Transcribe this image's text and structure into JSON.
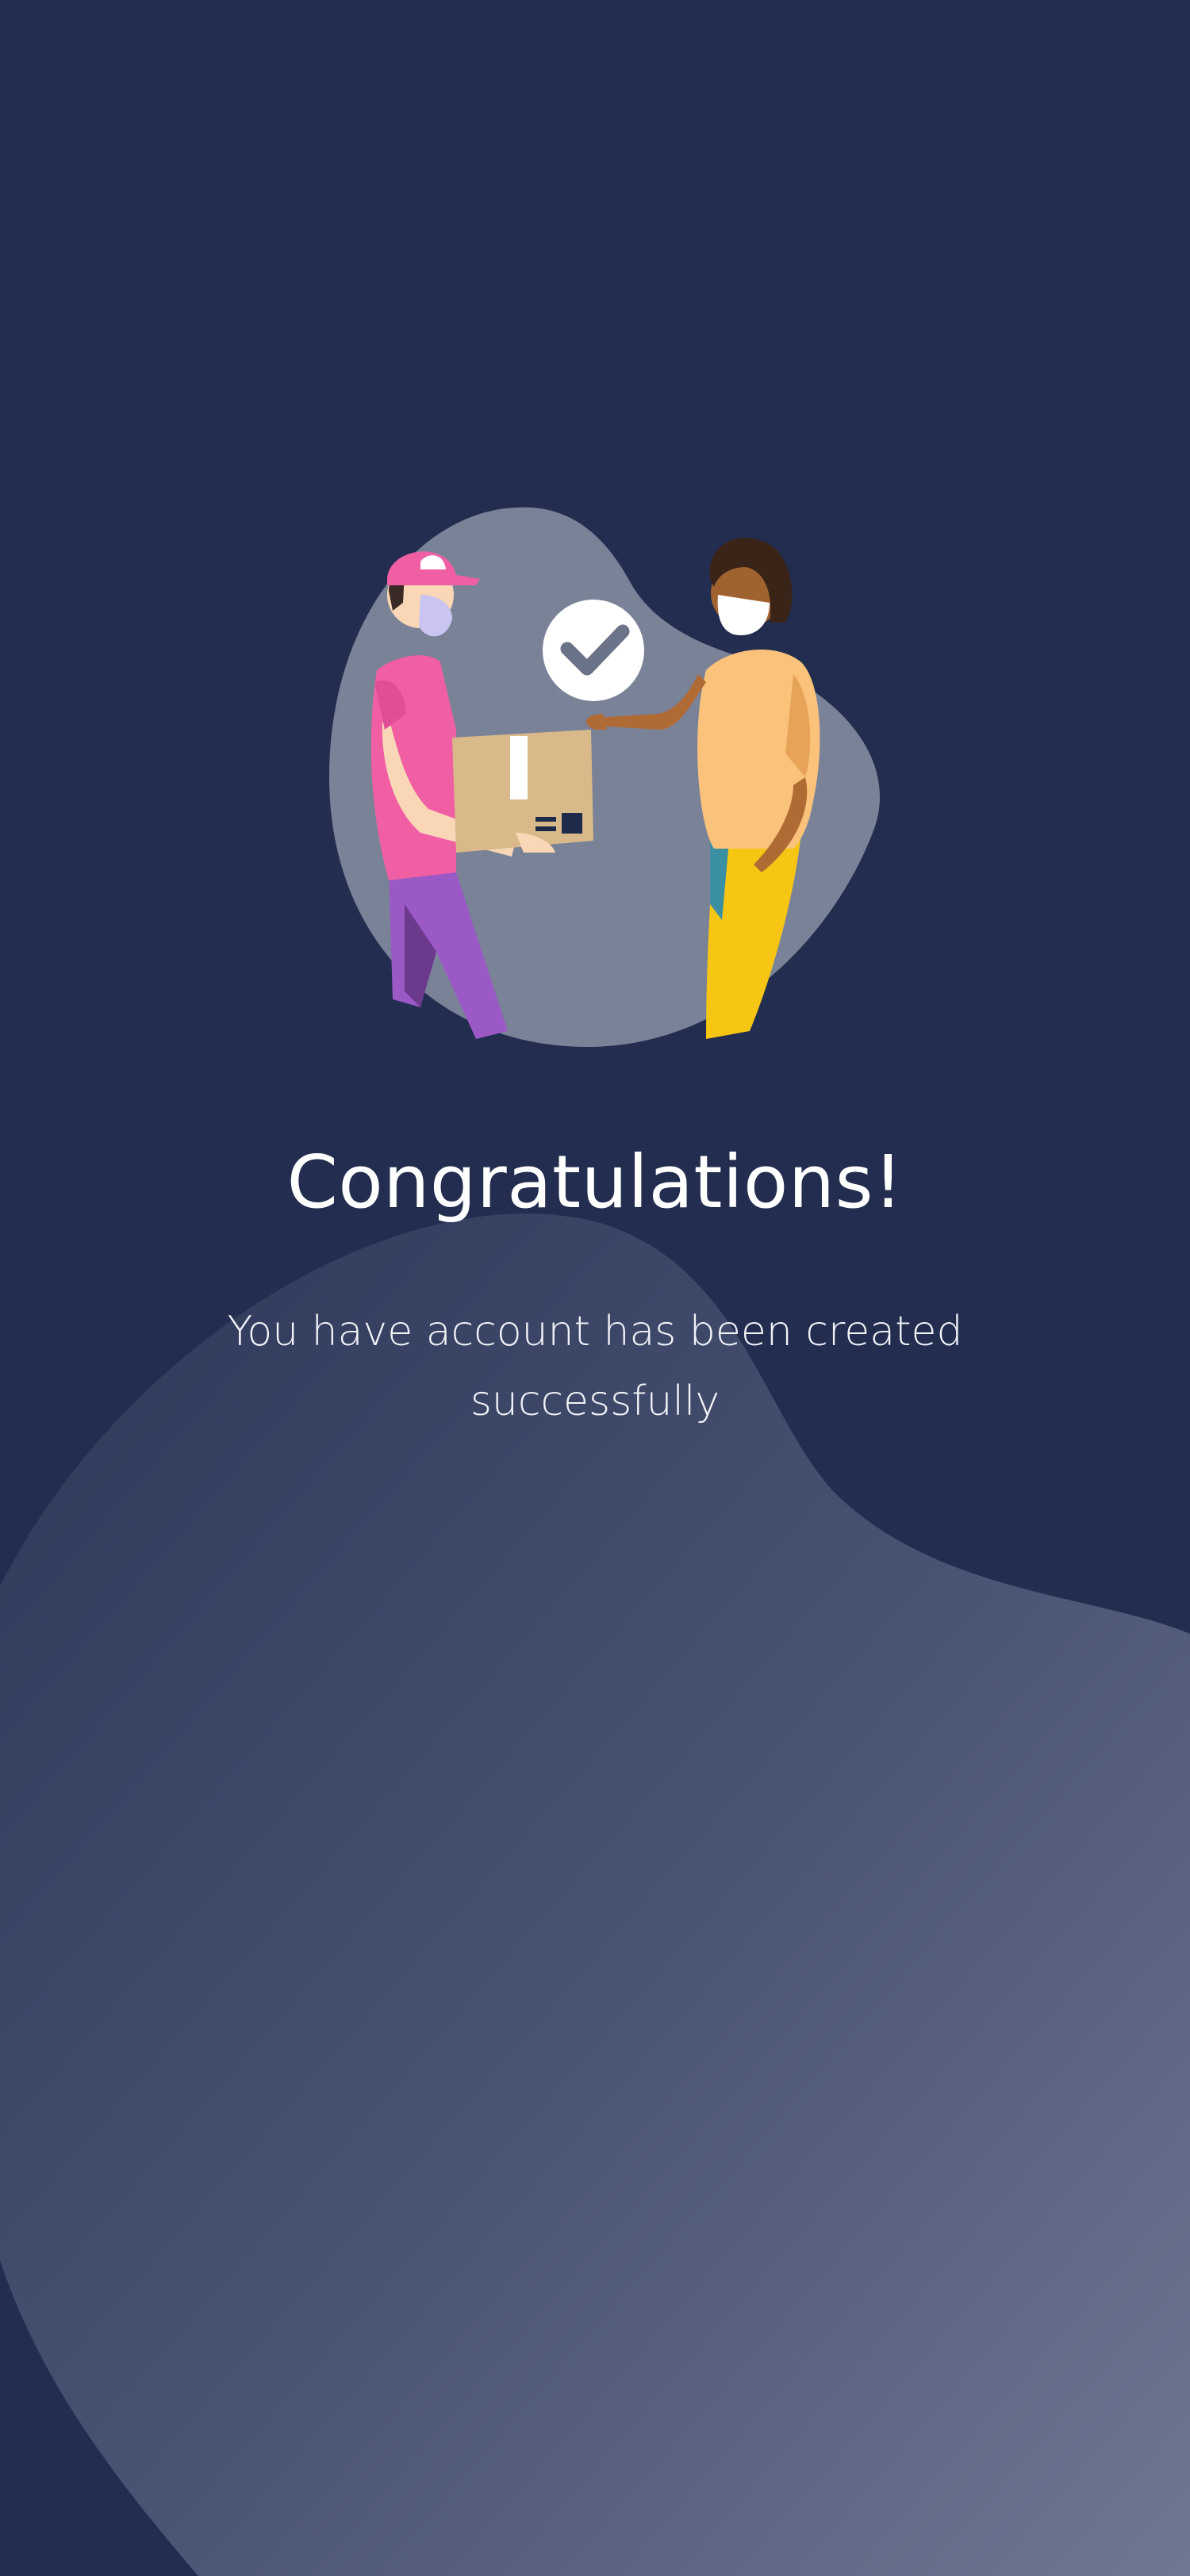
{
  "screen": {
    "title": "Congratulations!",
    "message": "You have account has been created successfully"
  },
  "colors": {
    "background": "#222d4f",
    "wave_light": "#6b7590",
    "blob": "#7a8298",
    "check_circle": "#ffffff",
    "check_mark": "#6b7388"
  },
  "illustration": {
    "icons": [
      "delivery-person-icon",
      "recipient-person-icon",
      "package-icon",
      "checkmark-icon"
    ]
  }
}
